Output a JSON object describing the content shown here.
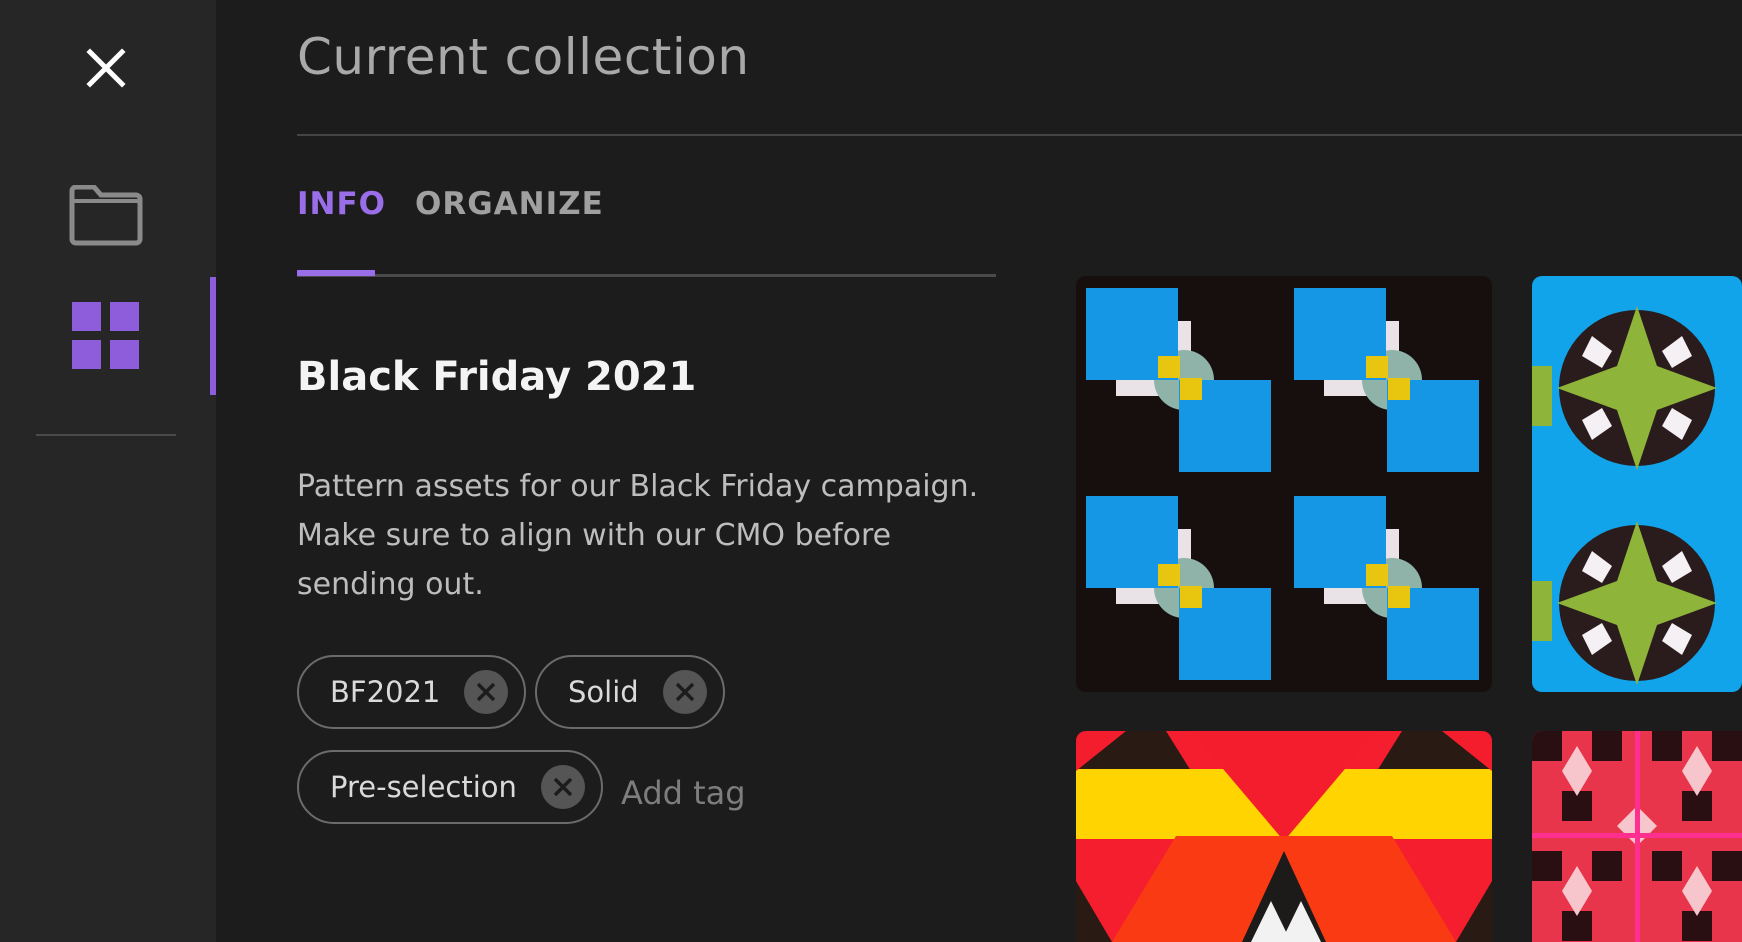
{
  "header": {
    "title": "Current collection"
  },
  "sidebar": {
    "close_icon": "close-icon",
    "items": [
      {
        "icon": "folder-icon",
        "active": false
      },
      {
        "icon": "grid-icon",
        "active": true
      }
    ],
    "accent": "#8e5ddb"
  },
  "tabs": [
    {
      "label": "INFO",
      "active": true
    },
    {
      "label": "ORGANIZE",
      "active": false
    }
  ],
  "collection": {
    "name": "Black Friday 2021",
    "description": "Pattern assets for our Black Friday campaign. Make sure to align with our CMO before sending out."
  },
  "tags": [
    {
      "label": "BF2021"
    },
    {
      "label": "Solid"
    },
    {
      "label": "Pre-selection"
    }
  ],
  "add_tag_label": "Add tag",
  "assets": [
    {
      "pattern": "blue-squares-pattern"
    },
    {
      "pattern": "blue-green-star-pattern"
    },
    {
      "pattern": "red-yellow-triangle-pattern"
    },
    {
      "pattern": "pink-red-cross-pattern"
    }
  ],
  "colors": {
    "background": "#1c1c1c",
    "sidebar": "#262626",
    "accent": "#9a6ee8"
  }
}
